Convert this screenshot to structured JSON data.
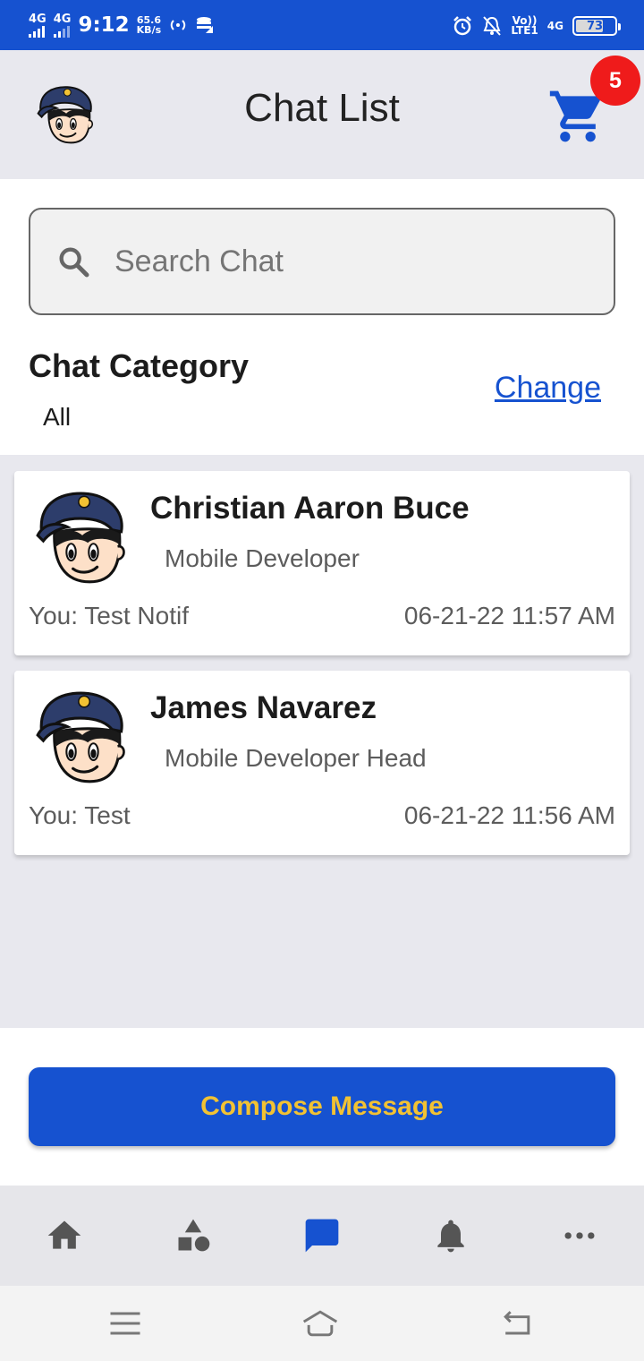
{
  "status_bar": {
    "network1": "4G",
    "network2": "4G",
    "time": "9:12",
    "speed_value": "65.6",
    "speed_unit": "KB/s",
    "volte_line1": "Vo))",
    "volte_line2": "LTE1",
    "network3": "4G",
    "battery": "73"
  },
  "header": {
    "title": "Chat List",
    "cart_badge": "5",
    "accent_color": "#1652d0",
    "badge_color": "#ef1b1b"
  },
  "search": {
    "placeholder": "Search Chat"
  },
  "category": {
    "title": "Chat Category",
    "value": "All",
    "change_link": "Change"
  },
  "chats": [
    {
      "name": "Christian Aaron Buce",
      "role": "Mobile Developer",
      "last_message": "You: Test Notif",
      "timestamp": "06-21-22 11:57 AM"
    },
    {
      "name": "James Navarez",
      "role": "Mobile Developer Head",
      "last_message": "You: Test",
      "timestamp": "06-21-22 11:56 AM"
    }
  ],
  "compose": {
    "label": "Compose Message",
    "label_color": "#f2c233"
  },
  "bottom_nav": {
    "items": [
      "home-icon",
      "shapes-icon",
      "chat-icon",
      "bell-icon",
      "more-icon"
    ],
    "active": "chat-icon"
  },
  "system_nav": [
    "menu-icon",
    "home-outline-icon",
    "back-icon"
  ]
}
